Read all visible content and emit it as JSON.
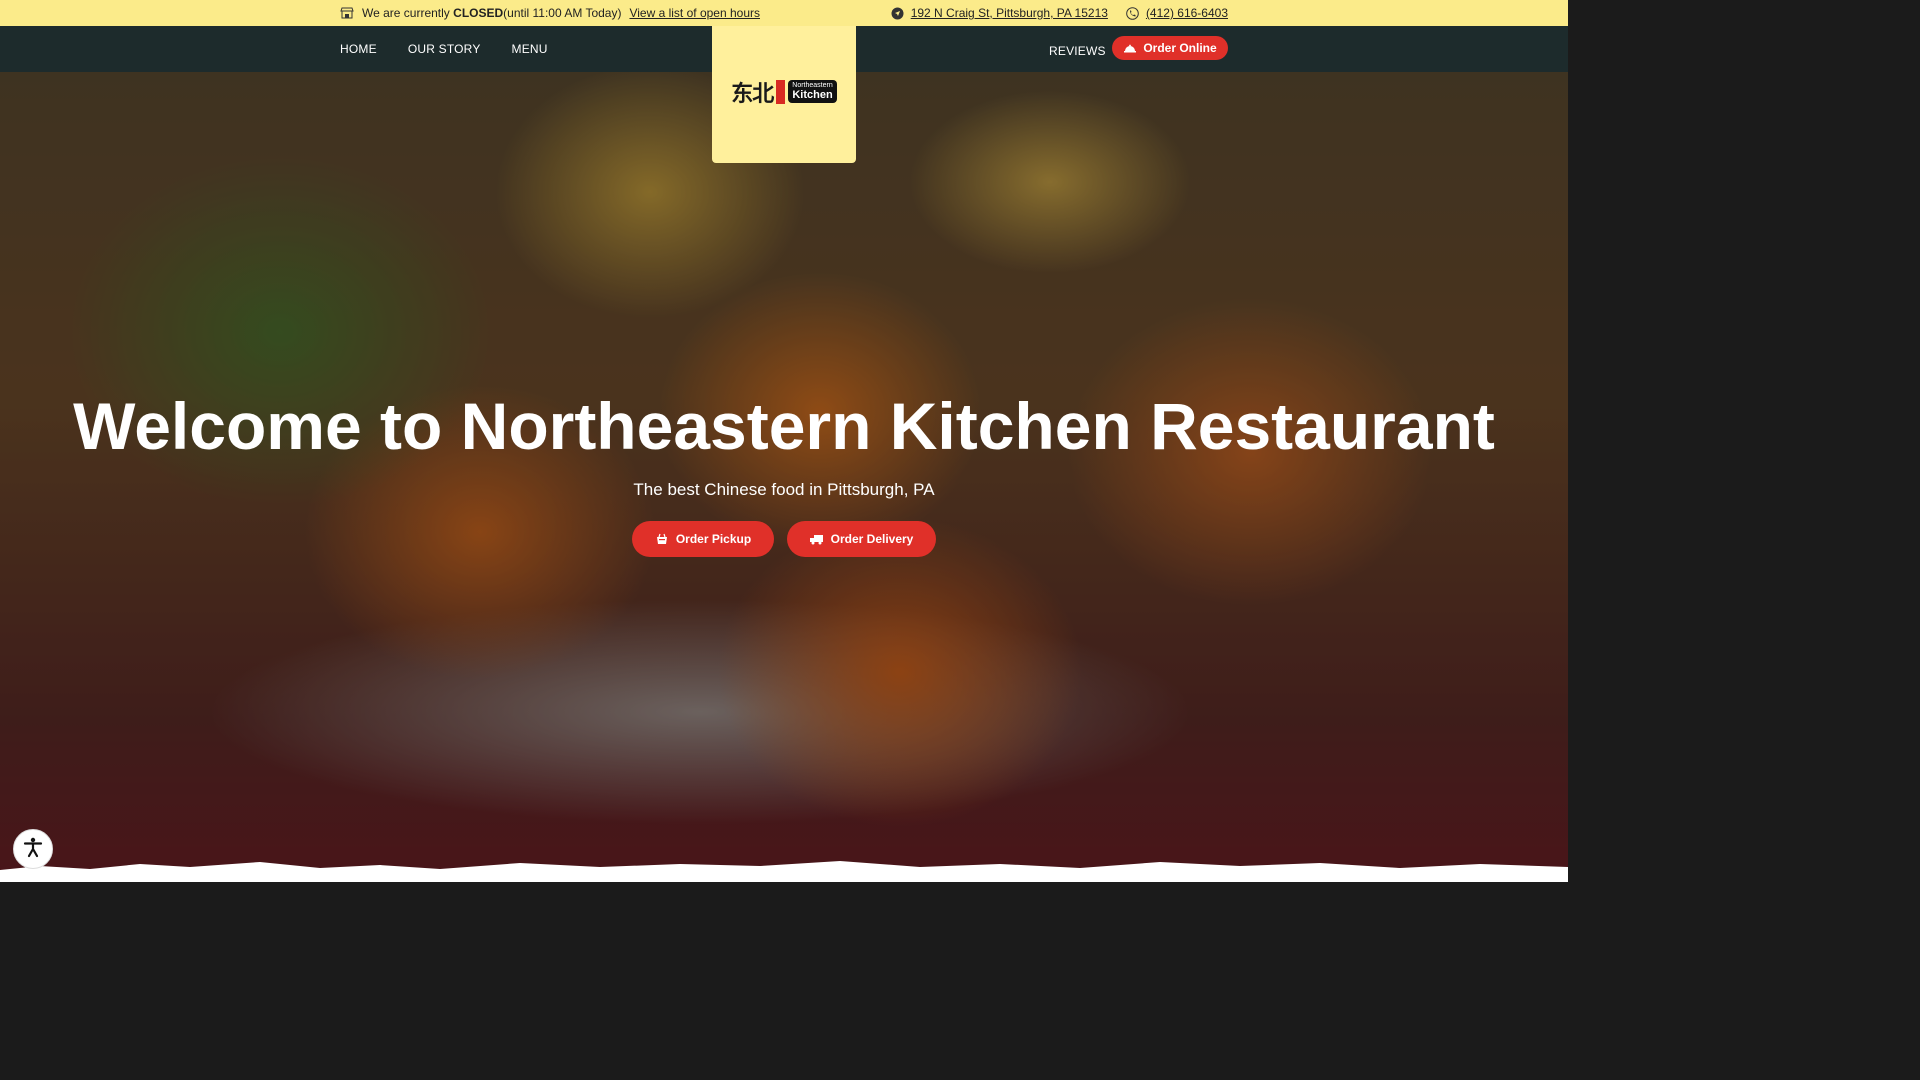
{
  "topbar": {
    "status_prefix": "We are currently ",
    "status_state": "CLOSED",
    "status_suffix": "(until 11:00 AM Today) ",
    "hours_link": "View a list of open hours",
    "address": "192 N Craig St, Pittsburgh, PA 15213",
    "phone": "(412) 616-6403"
  },
  "nav": {
    "items": [
      "HOME",
      "OUR STORY",
      "MENU"
    ],
    "reviews": "REVIEWS",
    "order_online": "Order Online"
  },
  "logo": {
    "chinese": "东北",
    "badge_small": "Northeastern",
    "badge_big": "Kitchen"
  },
  "hero": {
    "title": "Welcome to Northeastern Kitchen Restaurant",
    "subtitle": "The best Chinese food in Pittsburgh, PA",
    "pickup": "Order Pickup",
    "delivery": "Order Delivery"
  },
  "colors": {
    "topbar": "#fbeb8a",
    "nav": "#1d2b2c",
    "accent": "#e03029"
  },
  "icons": [
    "store-icon",
    "location-arrow-icon",
    "phone-icon",
    "food-cloche-icon",
    "pickup-basket-icon",
    "delivery-truck-icon",
    "accessibility-icon"
  ]
}
